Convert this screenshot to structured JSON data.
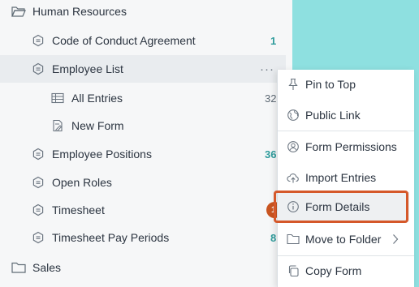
{
  "tree": {
    "folders": {
      "human_resources": "Human Resources",
      "sales": "Sales"
    },
    "forms": [
      {
        "label": "Code of Conduct Agreement",
        "count": "1"
      },
      {
        "label": "Employee List",
        "more": "···"
      },
      {
        "label": "Employee Positions",
        "count": "36"
      },
      {
        "label": "Open Roles"
      },
      {
        "label": "Timesheet",
        "badge": "1"
      },
      {
        "label": "Timesheet Pay Periods",
        "count": "8"
      }
    ],
    "employee_list_children": {
      "all_entries": {
        "label": "All Entries",
        "count": "32"
      },
      "new_form": {
        "label": "New Form"
      }
    }
  },
  "context_menu": {
    "items": [
      {
        "label": "Pin to Top",
        "icon": "pin-icon"
      },
      {
        "label": "Public Link",
        "icon": "globe-icon"
      },
      {
        "label": "Form Permissions",
        "icon": "user-circle-icon"
      },
      {
        "label": "Import Entries",
        "icon": "upload-icon"
      },
      {
        "label": "Form Details",
        "icon": "info-icon"
      },
      {
        "label": "Move to Folder",
        "icon": "folder-icon"
      },
      {
        "label": "Copy Form",
        "icon": "copy-icon"
      }
    ]
  },
  "colors": {
    "accent_teal": "#2f9c9c",
    "badge_orange": "#c95420",
    "highlight_border": "#d5582a",
    "background_teal": "#8ee0e0"
  }
}
